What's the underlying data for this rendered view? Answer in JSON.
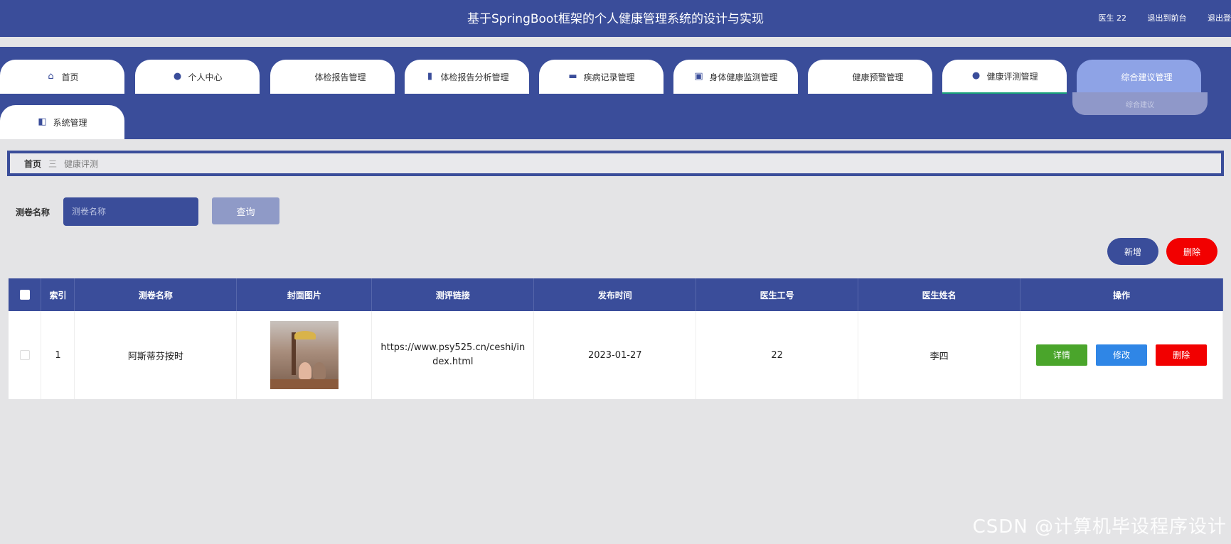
{
  "header": {
    "title": "基于SpringBoot框架的个人健康管理系统的设计与实现",
    "user": "医生 22",
    "to_front": "退出到前台",
    "logout": "退出登"
  },
  "nav": {
    "tabs": [
      {
        "label": "首页",
        "icon": "home-icon"
      },
      {
        "label": "个人中心",
        "icon": "user-icon"
      },
      {
        "label": "体检报告管理",
        "icon": "grid-icon"
      },
      {
        "label": "体检报告分析管理",
        "icon": "book-icon"
      },
      {
        "label": "疾病记录管理",
        "icon": "monitor-icon"
      },
      {
        "label": "身体健康监测管理",
        "icon": "briefcase-icon"
      },
      {
        "label": "健康预警管理",
        "icon": "grid-icon"
      },
      {
        "label": "健康评测管理",
        "icon": "bulb-icon"
      },
      {
        "label": "综合建议管理",
        "icon": "grid-icon"
      },
      {
        "label": "系统管理",
        "icon": "wallet-icon"
      }
    ],
    "submenu_item": "综合建议"
  },
  "breadcrumb": {
    "home": "首页",
    "separator": "三",
    "current": "健康评测"
  },
  "search": {
    "label": "测卷名称",
    "placeholder": "测卷名称",
    "button": "查询"
  },
  "actions": {
    "add": "新增",
    "delete": "删除"
  },
  "table": {
    "headers": [
      "索引",
      "测卷名称",
      "封面图片",
      "测评链接",
      "发布时间",
      "医生工号",
      "医生姓名",
      "操作"
    ],
    "rows": [
      {
        "index": "1",
        "name": "阿斯蒂芬按时",
        "link": "https://www.psy525.cn/ceshi/index.html",
        "publish_time": "2023-01-27",
        "doctor_id": "22",
        "doctor_name": "李四",
        "btn_detail": "详情",
        "btn_edit": "修改",
        "btn_delete": "删除"
      }
    ]
  },
  "watermark": "CSDN @计算机毕设程序设计",
  "colors": {
    "primary": "#3a4d9a",
    "active_tab": "#8ea3e6",
    "danger": "#f20000",
    "success": "#4aa52b",
    "info": "#2f86e6"
  }
}
